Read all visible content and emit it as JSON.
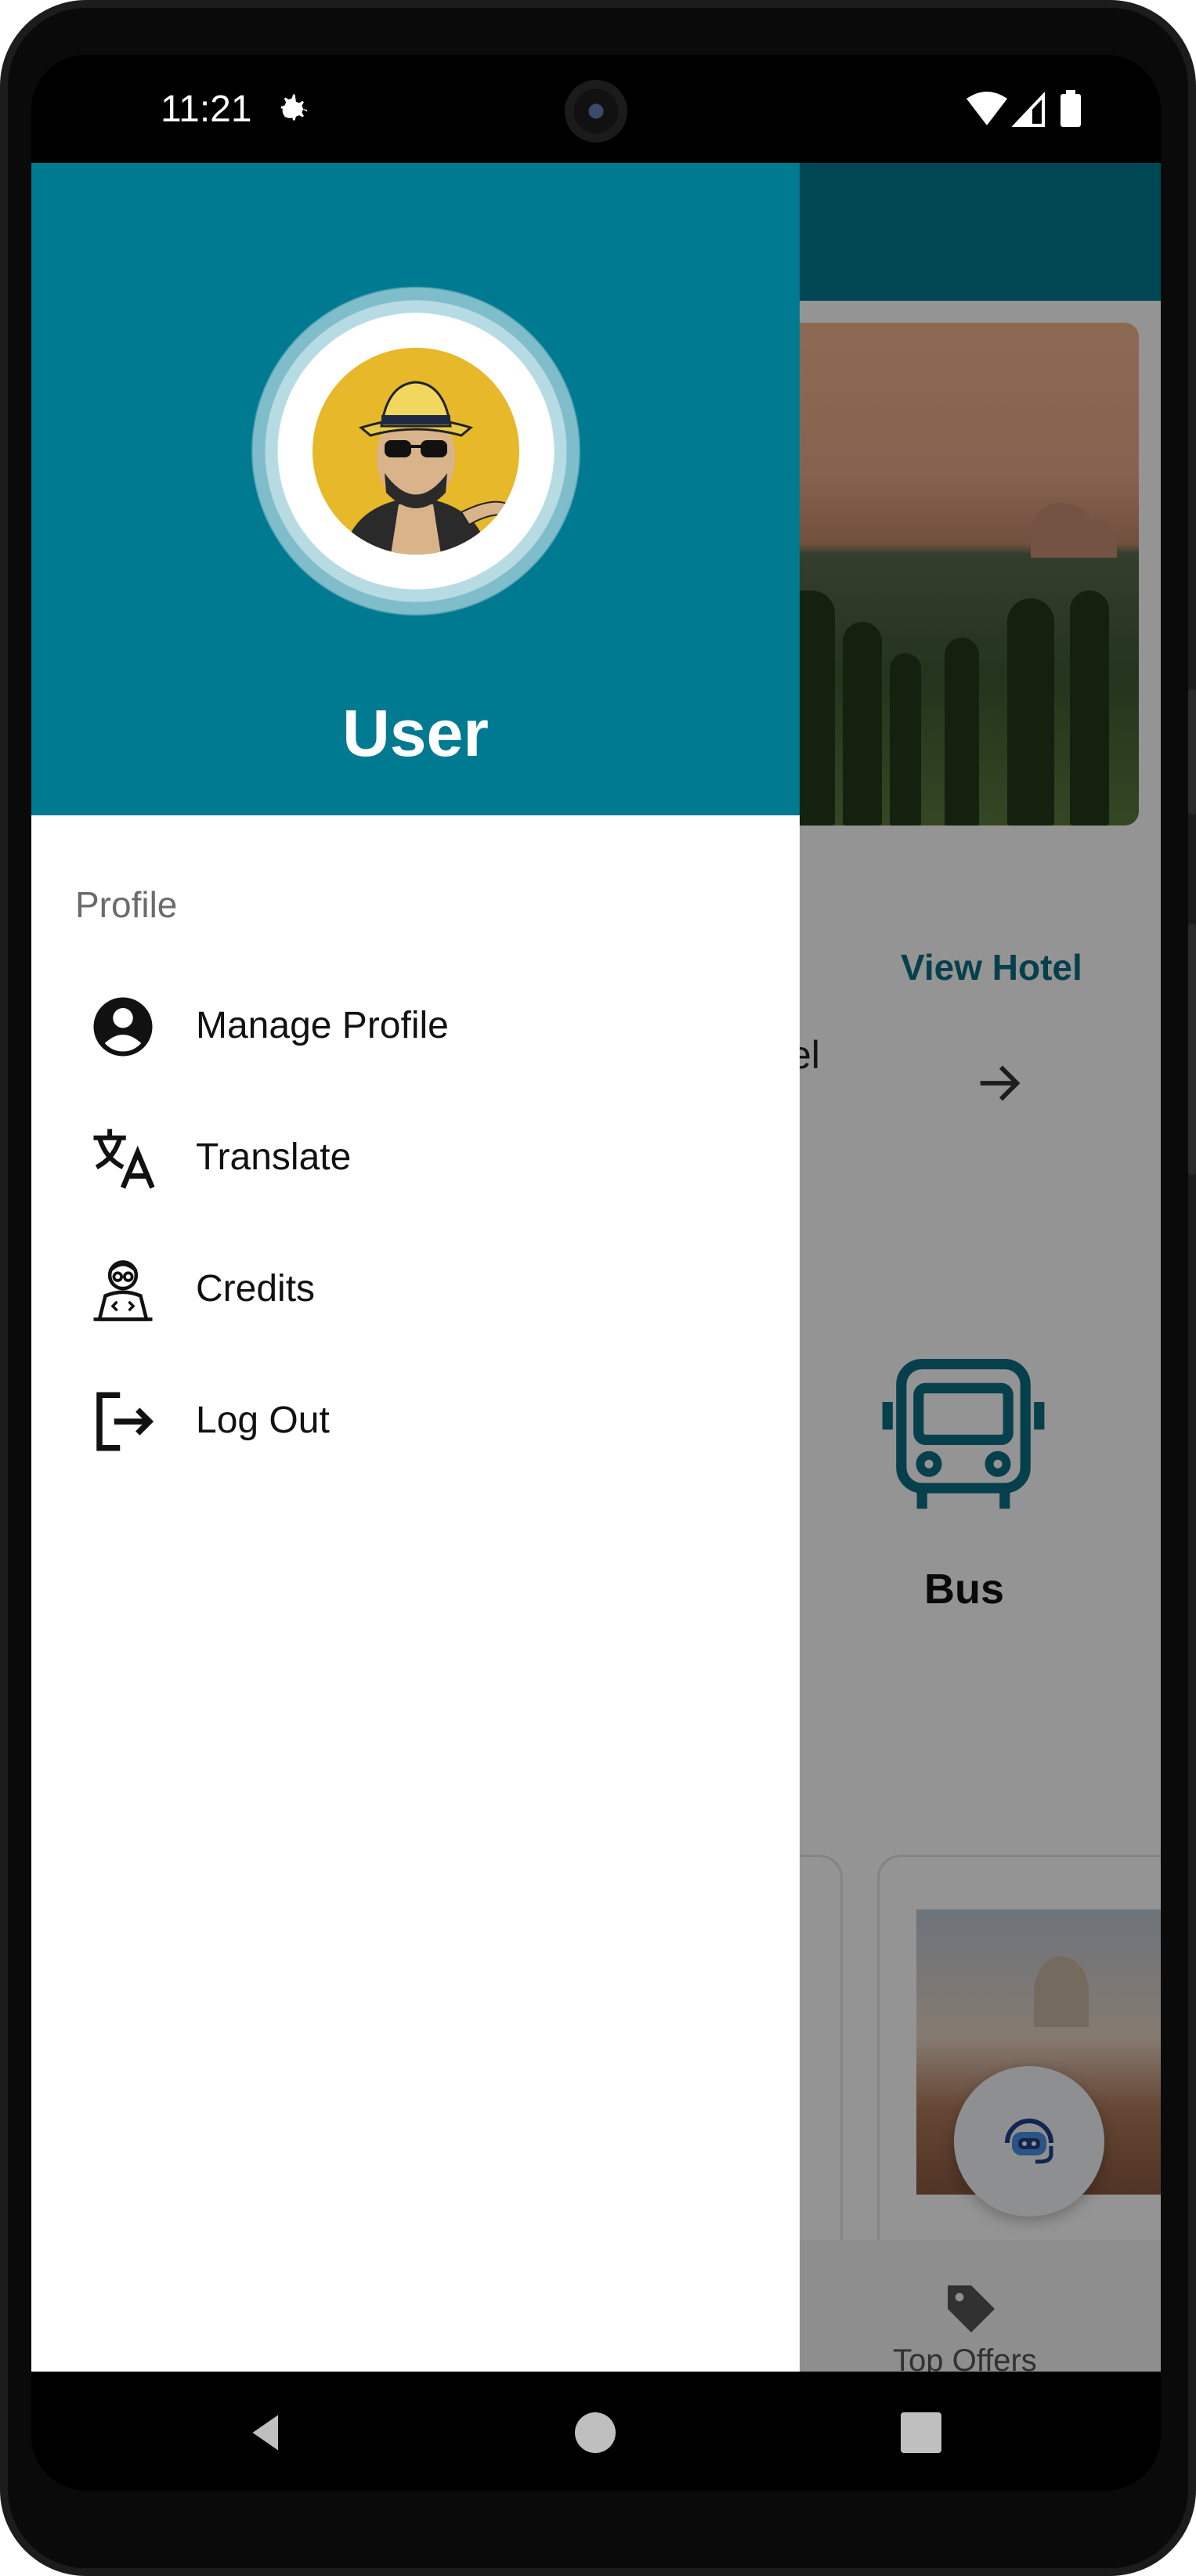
{
  "status_bar": {
    "time": "11:21"
  },
  "background": {
    "view_hotel": "View Hotel",
    "partial_label": "el",
    "bus_label": "Bus",
    "top_offers": "Top Offers"
  },
  "drawer": {
    "user_name": "User",
    "section_label": "Profile",
    "items": [
      {
        "label": "Manage Profile",
        "icon": "account-circle-icon"
      },
      {
        "label": "Translate",
        "icon": "translate-icon"
      },
      {
        "label": "Credits",
        "icon": "developer-icon"
      },
      {
        "label": "Log Out",
        "icon": "logout-icon"
      }
    ]
  },
  "colors": {
    "header_teal": "#007a91",
    "accent_teal": "#0b6e84"
  }
}
